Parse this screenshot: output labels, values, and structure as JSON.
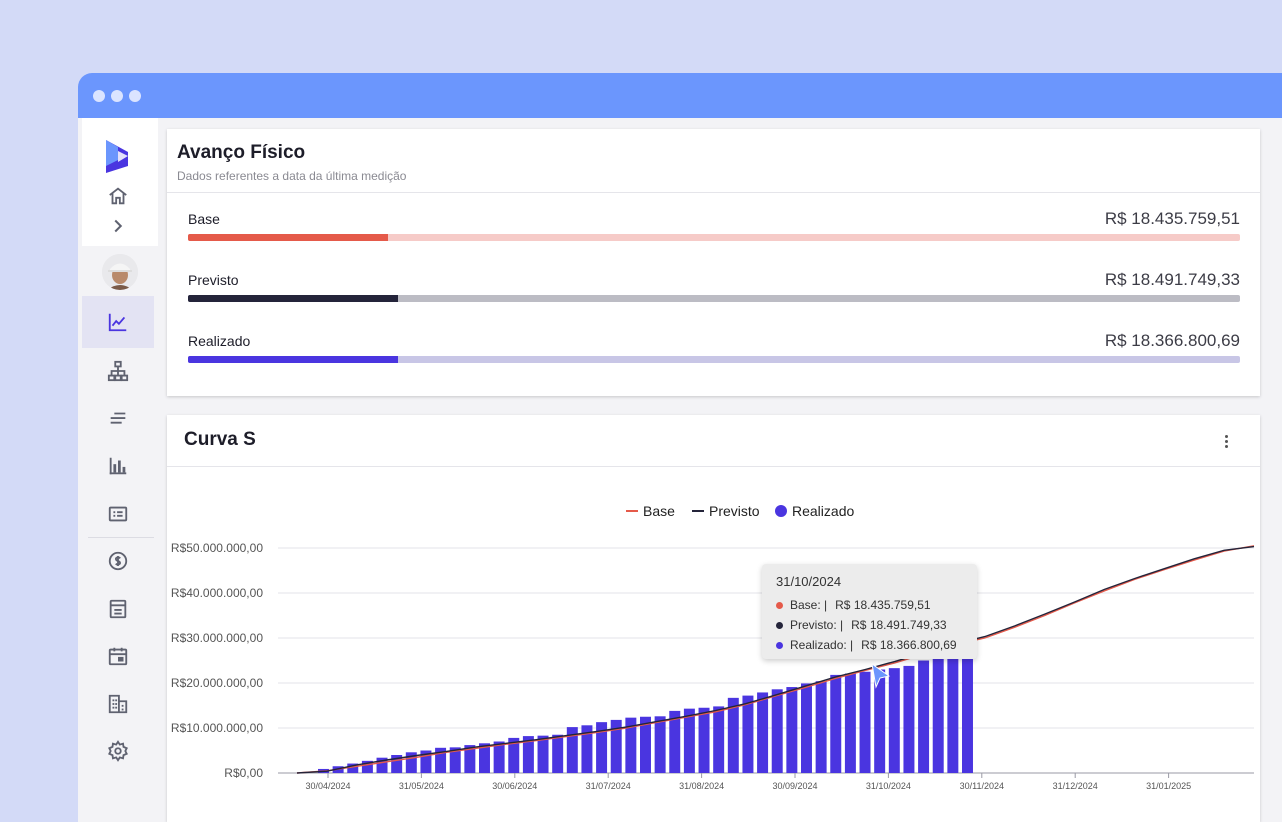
{
  "window": {
    "dots": 3
  },
  "sidebar": {
    "items": [
      {
        "name": "home-icon"
      },
      {
        "name": "chevron-right-icon"
      },
      {
        "name": "chart-line-icon",
        "active": true
      },
      {
        "name": "hierarchy-icon"
      },
      {
        "name": "list-icon"
      },
      {
        "name": "bar-chart-icon"
      },
      {
        "name": "card-icon"
      },
      {
        "name": "dollar-icon"
      },
      {
        "name": "document-icon"
      },
      {
        "name": "calendar-icon"
      },
      {
        "name": "building-icon"
      },
      {
        "name": "gear-icon"
      }
    ]
  },
  "avanco": {
    "title": "Avanço Físico",
    "subtitle": "Dados referentes a data da última medição",
    "rows": [
      {
        "label": "Base",
        "value": "R$ 18.435.759,51",
        "progress": 0.19,
        "color": "#e55a4a",
        "track": "#f6cbc8"
      },
      {
        "label": "Previsto",
        "value": "R$ 18.491.749,33",
        "progress": 0.2,
        "color": "#24243a",
        "track": "#bcbcc4"
      },
      {
        "label": "Realizado",
        "value": "R$ 18.366.800,69",
        "progress": 0.2,
        "color": "#4a35e0",
        "track": "#c8c6e6"
      }
    ]
  },
  "curva": {
    "title": "Curva S",
    "tooltip": {
      "date": "31/10/2024",
      "rows": [
        {
          "label": "Base: |",
          "value": "R$ 18.435.759,51",
          "color": "#e55a4a"
        },
        {
          "label": "Previsto: |",
          "value": "R$ 18.491.749,33",
          "color": "#24243a"
        },
        {
          "label": "Realizado: |",
          "value": "R$ 18.366.800,69",
          "color": "#4a35e0"
        }
      ]
    }
  },
  "chart_data": {
    "type": "bar",
    "legend": [
      "Base",
      "Previsto",
      "Realizado"
    ],
    "legend_position": "top-center",
    "colors": {
      "base": "#e55a4a",
      "previsto": "#24243a",
      "realizado": "#4a35e0"
    },
    "y_ticks": [
      "R$0,00",
      "R$10.000.000,00",
      "R$20.000.000,00",
      "R$30.000.000,00",
      "R$40.000.000,00",
      "R$50.000.000,00"
    ],
    "ylim": [
      0,
      50000000
    ],
    "x_ticks": [
      "30/04/2024",
      "31/05/2024",
      "30/06/2024",
      "31/07/2024",
      "31/08/2024",
      "30/09/2024",
      "31/10/2024",
      "30/11/2024",
      "31/12/2024",
      "31/01/2025"
    ],
    "grid": true,
    "realizado_bars_millions": [
      0.9,
      1.5,
      2.1,
      2.7,
      3.4,
      4.0,
      4.6,
      5.0,
      5.6,
      5.7,
      6.2,
      6.6,
      7.0,
      7.8,
      8.2,
      8.3,
      8.5,
      10.2,
      10.6,
      11.3,
      11.8,
      12.3,
      12.5,
      12.6,
      13.8,
      14.3,
      14.5,
      14.8,
      16.7,
      17.2,
      17.9,
      18.6,
      19.1,
      19.9,
      20.4,
      21.8,
      22.1,
      22.5,
      23.0,
      23.3,
      23.8,
      25.0,
      25.6,
      26.1,
      26.6
    ],
    "base_millions": [
      0,
      0.5,
      1.5,
      2.5,
      3.5,
      4.6,
      5.5,
      6.4,
      7.2,
      8.1,
      9.0,
      10.0,
      11.2,
      12.4,
      13.6,
      15.2,
      17.1,
      19.0,
      21.0,
      22.8,
      24.5,
      26.5,
      28.5,
      30.0,
      32.4,
      35.0,
      37.8,
      40.5,
      43.0,
      45.2,
      47.3,
      49.3,
      50.5
    ],
    "previsto_millions": [
      0,
      0.4,
      1.8,
      2.9,
      3.9,
      4.8,
      5.8,
      6.6,
      7.4,
      8.3,
      9.2,
      10.2,
      11.4,
      12.6,
      13.9,
      15.4,
      17.3,
      19.3,
      21.3,
      23.0,
      24.8,
      26.8,
      28.7,
      30.3,
      32.7,
      35.3,
      38.0,
      40.8,
      43.2,
      45.4,
      47.6,
      49.5,
      50.3
    ]
  }
}
